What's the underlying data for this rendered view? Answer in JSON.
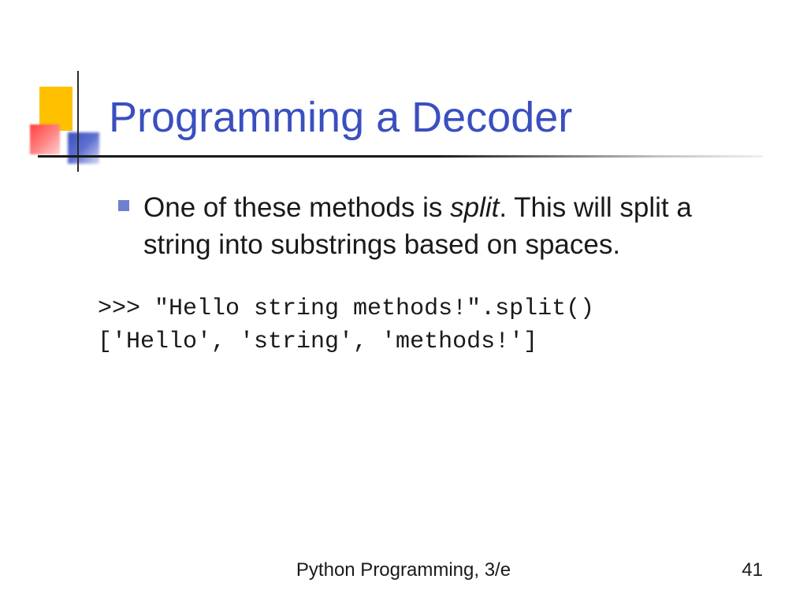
{
  "title": "Programming a Decoder",
  "bullet": {
    "pre": "One of these methods is ",
    "italic": "split",
    "post": ". This will split a string into substrings based on spaces."
  },
  "code": {
    "line1": ">>> \"Hello string methods!\".split()",
    "line2": "['Hello', 'string', 'methods!']"
  },
  "footer": "Python Programming, 3/e",
  "page": "41"
}
